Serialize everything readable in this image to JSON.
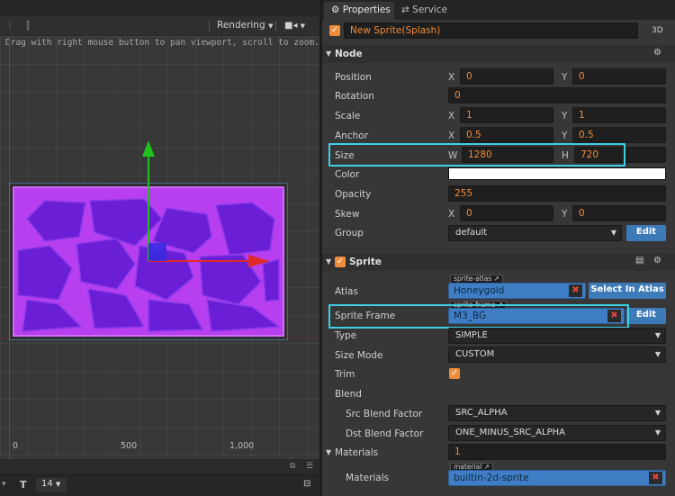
{
  "scene": {
    "render_mode": "Rendering",
    "hint": "Drag with right mouse button to pan viewport, scroll to zoom.",
    "axis_labels": [
      "0",
      "500",
      "1,000"
    ],
    "font_size_value": "14",
    "colors": {
      "sprite_fill": "#b83ff0",
      "hex_fill": "#6a1fd6",
      "gizmo_x": "#e02a2a",
      "gizmo_y": "#1fc21f",
      "gizmo_center": "#3a2ae0"
    }
  },
  "tabs": {
    "properties": "Properties",
    "service": "Service"
  },
  "node_name": "New Sprite(Splash)",
  "badge_3d": "3D",
  "node": {
    "section": "Node",
    "position": {
      "label": "Position",
      "x": "0",
      "y": "0"
    },
    "rotation": {
      "label": "Rotation",
      "value": "0"
    },
    "scale": {
      "label": "Scale",
      "x": "1",
      "y": "1"
    },
    "anchor": {
      "label": "Anchor",
      "x": "0.5",
      "y": "0.5"
    },
    "size": {
      "label": "Size",
      "w": "1280",
      "h": "720"
    },
    "color": {
      "label": "Color",
      "value": "#ffffff"
    },
    "opacity": {
      "label": "Opacity",
      "value": "255"
    },
    "skew": {
      "label": "Skew",
      "x": "0",
      "y": "0"
    },
    "group": {
      "label": "Group",
      "value": "default",
      "edit": "Edit"
    },
    "axis": {
      "x": "X",
      "y": "Y",
      "w": "W",
      "h": "H"
    }
  },
  "sprite": {
    "section": "Sprite",
    "atlas": {
      "label": "Atlas",
      "tag": "sprite-atlas",
      "value": "Honeygold",
      "select": "Select In Atlas"
    },
    "frame": {
      "label": "Sprite Frame",
      "tag": "sprite-frame",
      "value": "M3_BG",
      "edit": "Edit"
    },
    "type": {
      "label": "Type",
      "value": "SIMPLE"
    },
    "size_mode": {
      "label": "Size Mode",
      "value": "CUSTOM"
    },
    "trim": {
      "label": "Trim",
      "checked": true
    },
    "blend": {
      "label": "Blend"
    },
    "src_blend": {
      "label": "Src Blend Factor",
      "value": "SRC_ALPHA"
    },
    "dst_blend": {
      "label": "Dst Blend Factor",
      "value": "ONE_MINUS_SRC_ALPHA"
    },
    "materials_count": {
      "label": "Materials",
      "value": "1"
    },
    "materials": {
      "label": "Materials",
      "tag": "material",
      "value": "builtin-2d-sprite"
    }
  }
}
